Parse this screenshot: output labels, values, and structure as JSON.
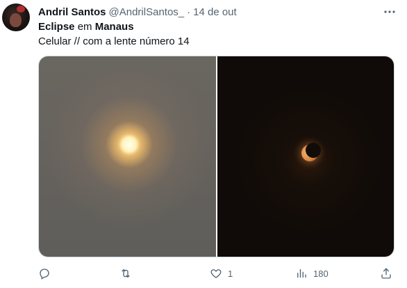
{
  "tweet": {
    "author": {
      "name": "Andril Santos",
      "handle": "@AndrilSantos_",
      "avatar_icon": "avatar-photo"
    },
    "separator": "·",
    "timestamp": "14 de out",
    "more_icon": "more-horizontal-icon",
    "text": {
      "line1": {
        "word1": "Eclipse",
        "word2": " em ",
        "word3": "Manaus"
      },
      "line2": "Celular // com a lente número 14"
    },
    "media": {
      "photos": [
        {
          "description_icon": "sun-photo"
        },
        {
          "description_icon": "eclipse-crescent-photo"
        }
      ]
    },
    "actions": {
      "reply": {
        "icon": "reply-icon",
        "count": ""
      },
      "retweet": {
        "icon": "retweet-icon",
        "count": ""
      },
      "like": {
        "icon": "heart-icon",
        "count": "1"
      },
      "views": {
        "icon": "views-icon",
        "count": "180"
      },
      "share": {
        "icon": "share-icon",
        "count": ""
      }
    }
  },
  "colors": {
    "text_primary": "#0f1419",
    "text_secondary": "#536471",
    "border": "#cfd9de"
  }
}
